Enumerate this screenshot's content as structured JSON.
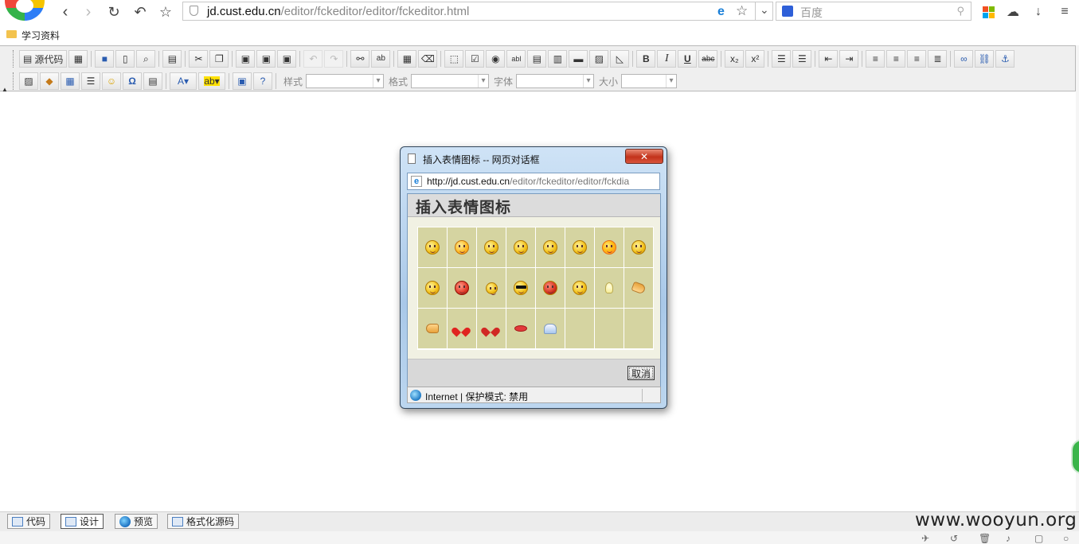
{
  "browser": {
    "url_host": "jd.cust.edu.cn",
    "url_path": "/editor/fckeditor/editor/fckeditor.html",
    "search_placeholder": "百度",
    "bookmark_folder": "学习资料"
  },
  "toolbar": {
    "source_label": "源代码",
    "style_label": "样式",
    "format_label": "格式",
    "font_label": "字体",
    "size_label": "大小"
  },
  "dialog": {
    "title": "插入表情图标 -- 网页对话框",
    "address_host": "http://jd.cust.edu.cn",
    "address_path": "/editor/fckeditor/editor/fckdia",
    "heading": "插入表情图标",
    "cancel_label": "取消",
    "status_text": "Internet | 保护模式: 禁用",
    "smileys": [
      "smile-icon",
      "sad-icon",
      "wink-icon",
      "grin-icon",
      "confused-icon",
      "tongue-icon",
      "embarrassed-icon",
      "surprised-icon",
      "neutral-icon",
      "angry-icon",
      "whatchutalkingabout-icon",
      "cool-icon",
      "devil-icon",
      "cry-icon",
      "lightbulb-icon",
      "thumbs-down-icon",
      "thumbs-up-icon",
      "heart-icon",
      "broken-heart-icon",
      "kiss-icon",
      "envelope-icon"
    ]
  },
  "bottom_tabs": [
    "代码",
    "设计",
    "预览",
    "格式化源码"
  ],
  "watermark": "www.wooyun.org",
  "colors": {
    "dialog_frame": "#a9c8e8",
    "smiley_cell": "#d5d4a1",
    "close_button": "#c3321b"
  }
}
